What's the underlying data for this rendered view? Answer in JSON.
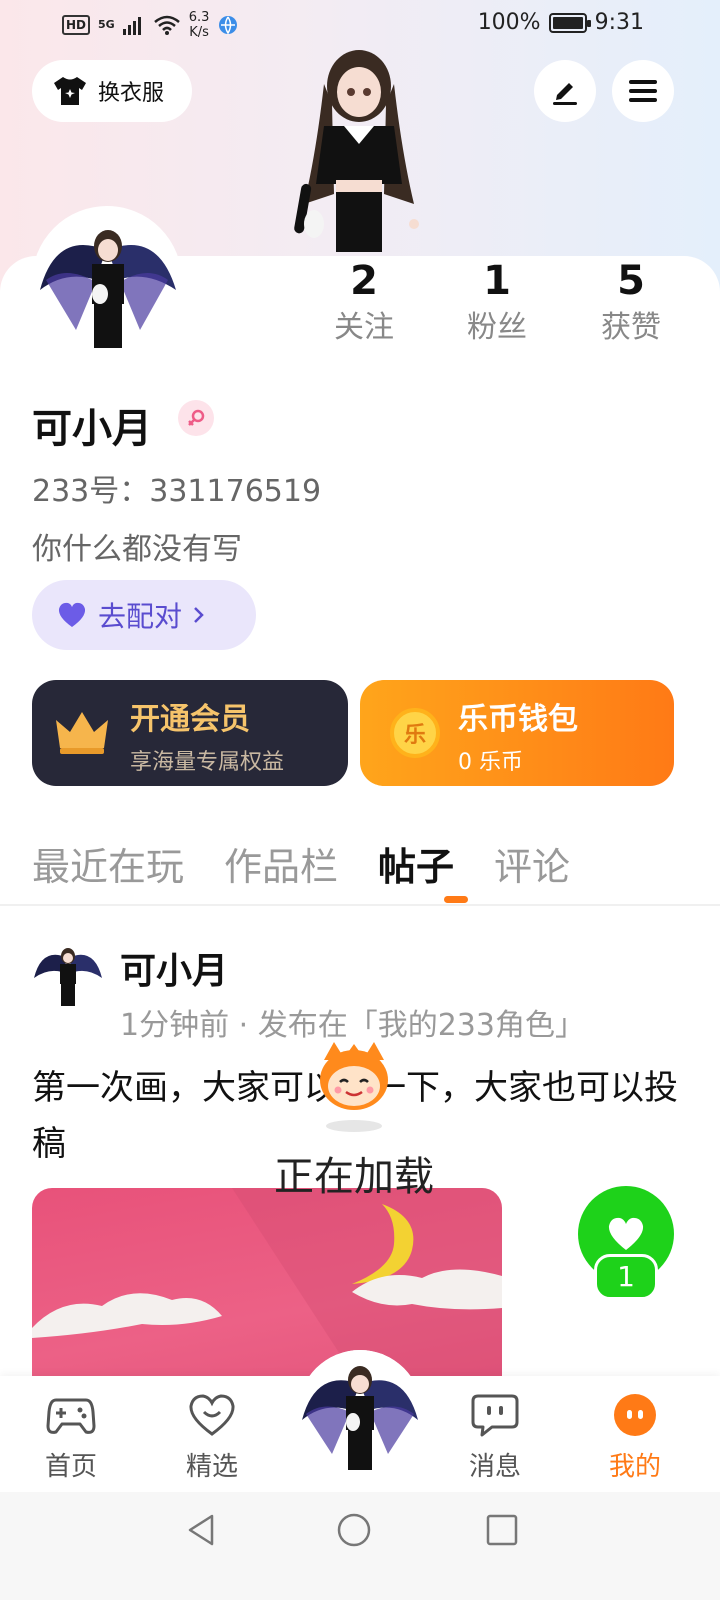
{
  "status_bar": {
    "hd": "HD",
    "network": "5G",
    "speed_value": "6.3",
    "speed_unit": "K/s",
    "battery": "100%",
    "time": "9:31"
  },
  "header": {
    "dress_label": "换衣服"
  },
  "stats": [
    {
      "num": "2",
      "label": "关注"
    },
    {
      "num": "1",
      "label": "粉丝"
    },
    {
      "num": "5",
      "label": "获赞"
    }
  ],
  "profile": {
    "name": "可小月",
    "uid": "233号：331176519",
    "bio": "你什么都没有写",
    "pair_label": "去配对"
  },
  "vip": {
    "title": "开通会员",
    "subtitle": "享海量专属权益"
  },
  "wallet": {
    "title": "乐币钱包",
    "subtitle": "0 乐币",
    "coin_glyph": "乐"
  },
  "tabs": [
    {
      "label": "最近在玩"
    },
    {
      "label": "作品栏"
    },
    {
      "label": "帖子"
    },
    {
      "label": "评论"
    }
  ],
  "post": {
    "author": "可小月",
    "meta": "1分钟前 · 发布在「我的233角色」",
    "text": "第一次画，大家可以看一下，大家也可以投稿",
    "likes": "1"
  },
  "loading_text": "正在加载",
  "nav": [
    {
      "label": "首页"
    },
    {
      "label": "精选"
    },
    {
      "label": "消息"
    },
    {
      "label": "我的"
    }
  ],
  "colors": {
    "accent": "#ff7a16",
    "like_green": "#1ed21a",
    "vip_dark": "#272838",
    "pair_purple": "#5a4ccf"
  }
}
